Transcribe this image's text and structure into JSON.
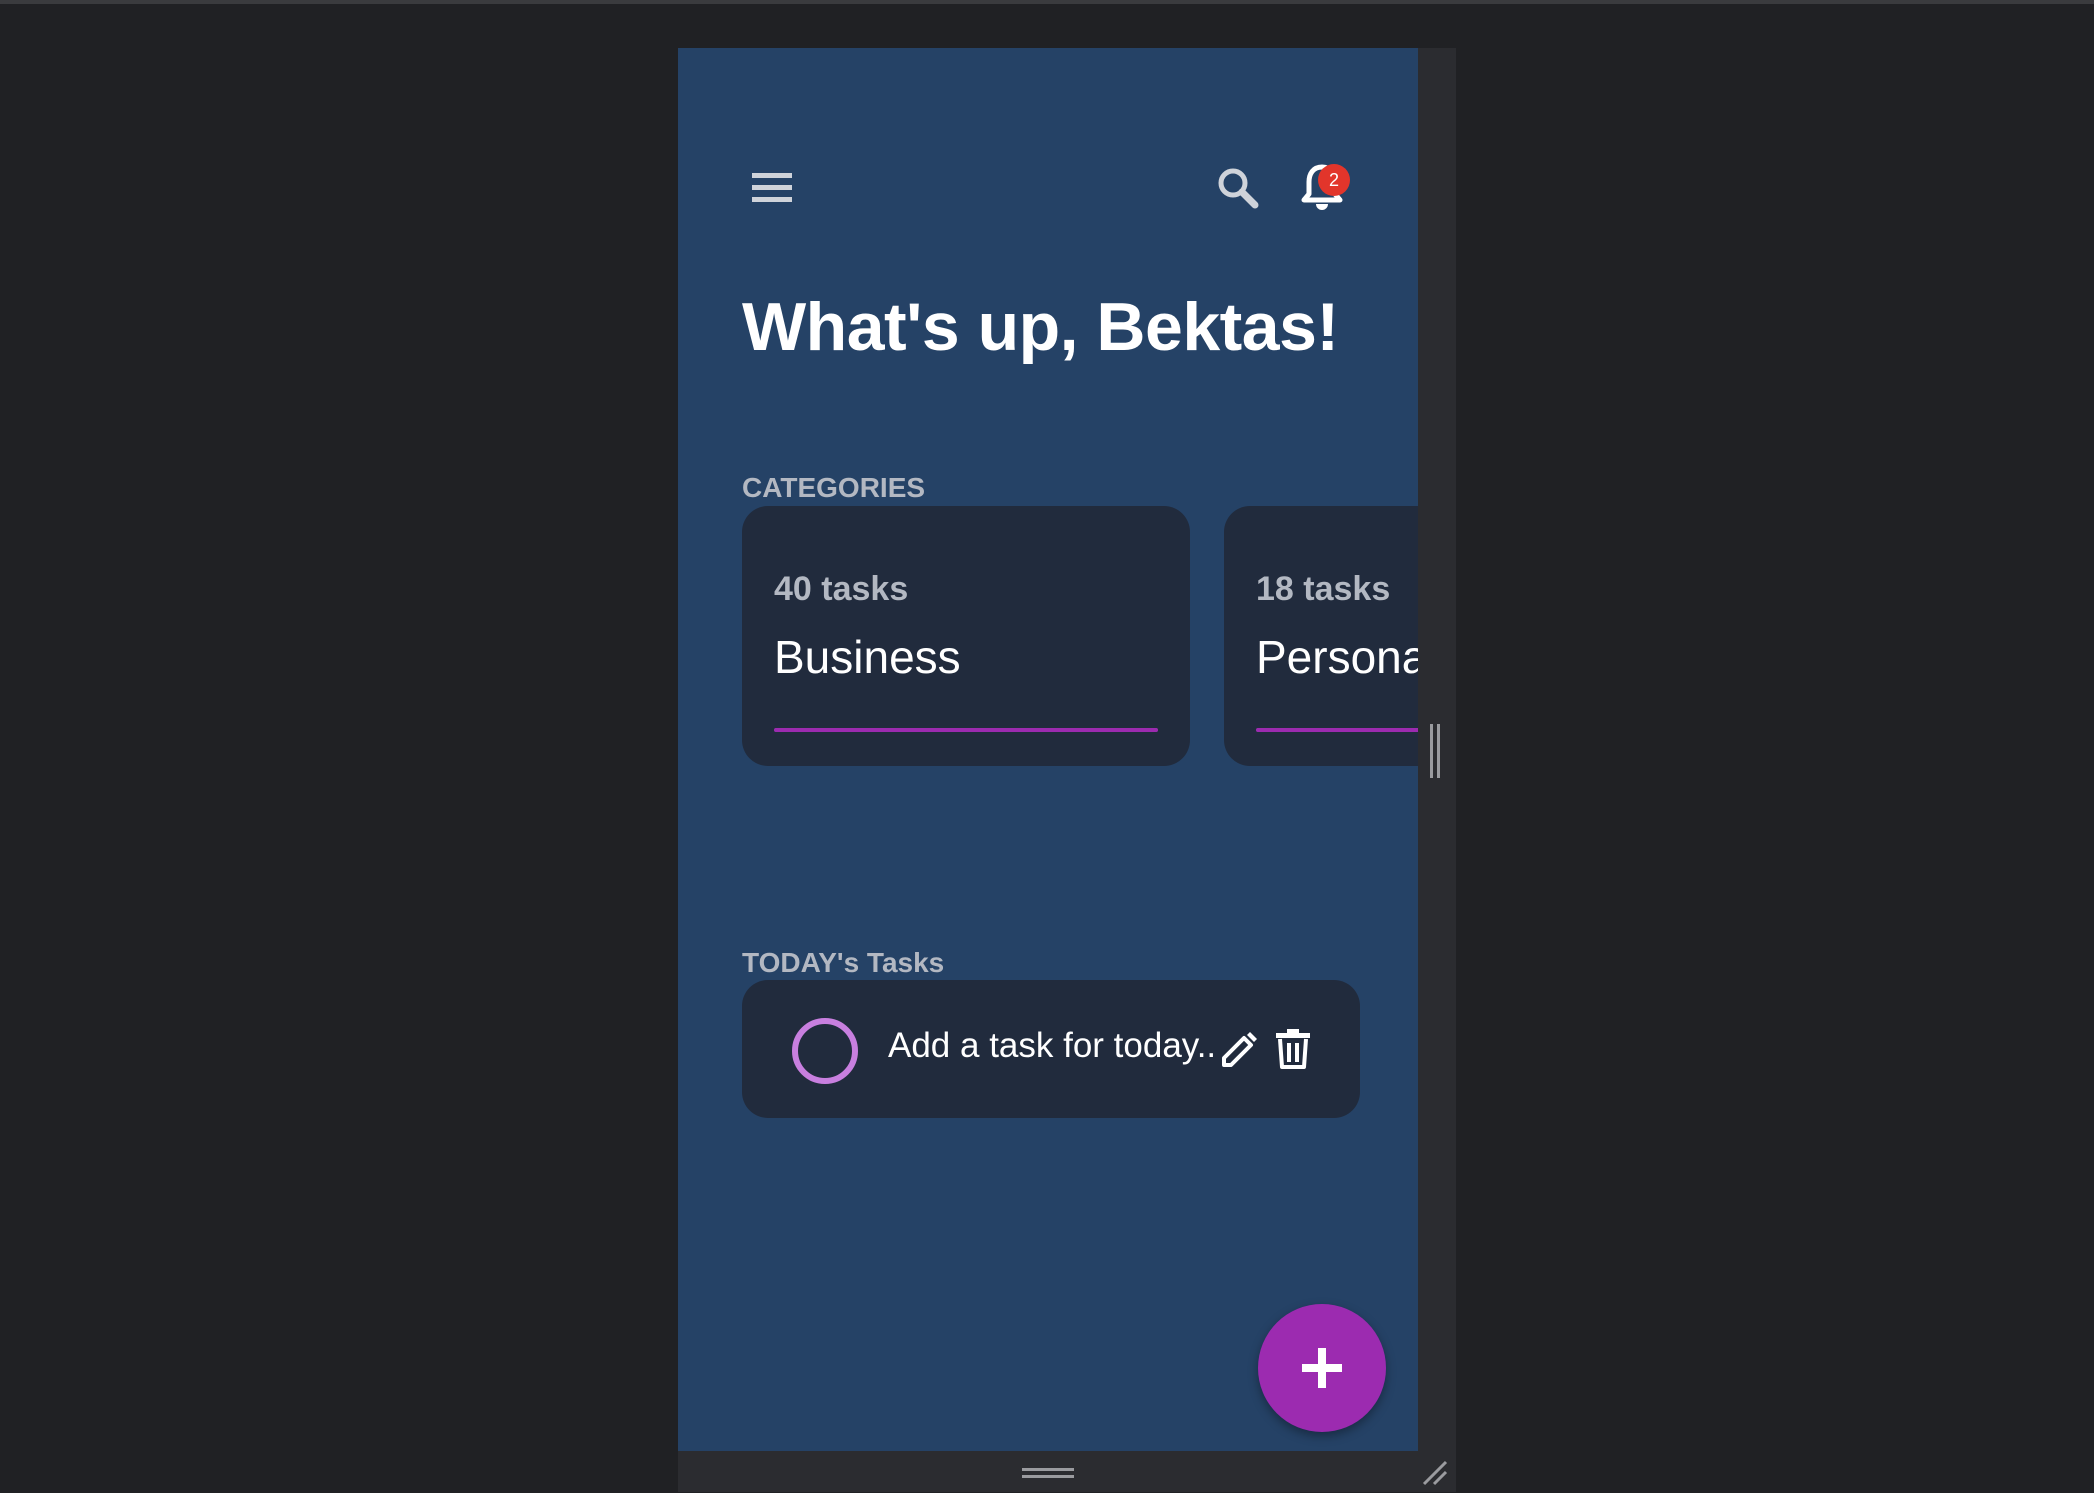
{
  "header": {
    "menu_icon": "menu-icon",
    "search_icon": "search-icon",
    "notifications_icon": "bell-icon",
    "notification_count": "2"
  },
  "greeting": "What's up, Bektas!",
  "categories": {
    "label": "CATEGORIES",
    "items": [
      {
        "count": "40 tasks",
        "name": "Business",
        "progress": 1.0,
        "color": "#9c2bb0"
      },
      {
        "count": "18 tasks",
        "name": "Personal",
        "progress": 1.0,
        "color": "#9c2bb0"
      }
    ]
  },
  "today": {
    "label": "TODAY's Tasks",
    "tasks": [
      {
        "text": "Add a task for today..",
        "done": false
      }
    ]
  },
  "fab": {
    "icon": "plus-icon"
  },
  "colors": {
    "background": "#254266",
    "card": "#212b3d",
    "accent": "#9c2bb0",
    "badge": "#e2352b"
  }
}
